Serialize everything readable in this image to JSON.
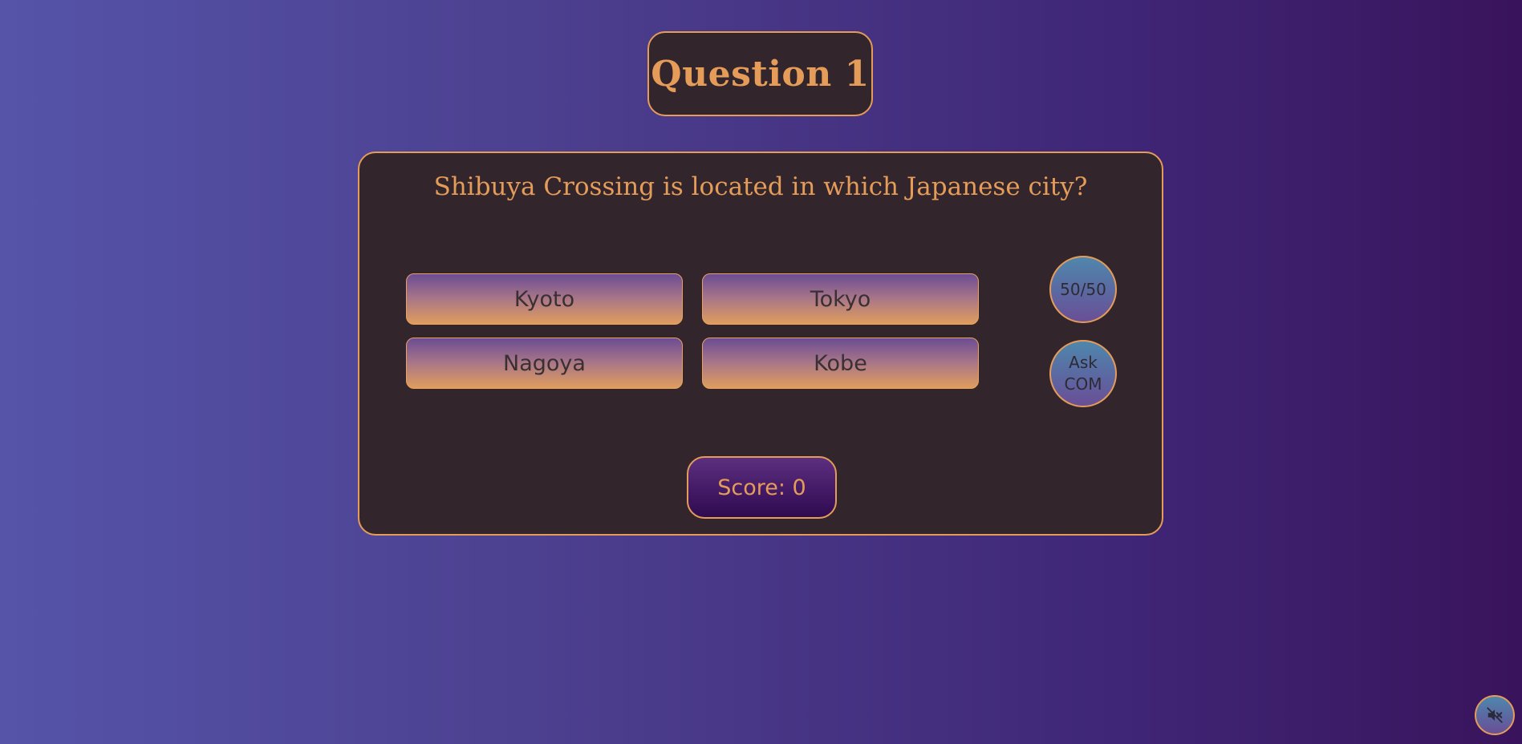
{
  "header": {
    "title": "Question 1"
  },
  "question": {
    "text": "Shibuya Crossing is located in which Japanese city?"
  },
  "answers": [
    {
      "label": "Kyoto"
    },
    {
      "label": "Tokyo"
    },
    {
      "label": "Nagoya"
    },
    {
      "label": "Kobe"
    }
  ],
  "lifelines": {
    "fifty_fifty": {
      "label": "50/50"
    },
    "ask_com": {
      "line1": "Ask",
      "line2": "COM"
    }
  },
  "score": {
    "label": "Score: 0"
  },
  "sound": {
    "icon": "speaker-muted-icon"
  },
  "colors": {
    "accent": "#e59c59",
    "panel": "#32252c",
    "background_start": "#5554a9",
    "background_end": "#39145c"
  }
}
